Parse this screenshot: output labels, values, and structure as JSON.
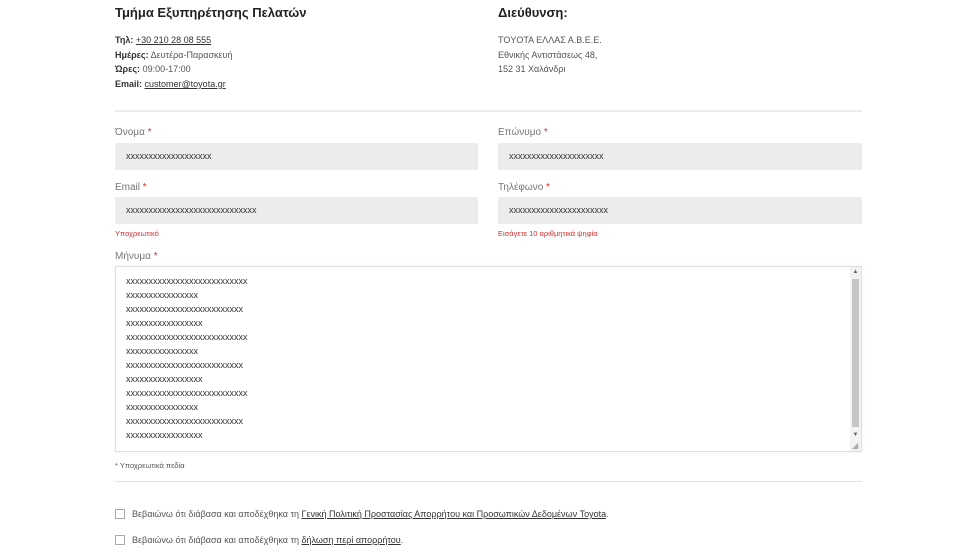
{
  "customer_service": {
    "title": "Τμήμα Εξυπηρέτησης Πελατών",
    "phone_label": "Τηλ:",
    "phone_value": "+30 210 28 08 555",
    "days_label": "Ημέρες:",
    "days_value": "Δευτέρα-Παρασκευή",
    "hours_label": "Ώρες:",
    "hours_value": "09:00-17:00",
    "email_label": "Email:",
    "email_value": "customer@toyota.gr"
  },
  "address": {
    "title": "Διεύθυνση:",
    "line1": "TOYOTA ΕΛΛΑΣ Α.Β.Ε.Ε.",
    "line2": "Εθνικής Αντιστάσεως 48,",
    "line3": "152 31 Χαλάνδρι"
  },
  "required_marker": "*",
  "form": {
    "first_name": {
      "label": "Όνομα",
      "value": "xxxxxxxxxxxxxxxxxxx"
    },
    "last_name": {
      "label": "Επώνυμο",
      "value": "xxxxxxxxxxxxxxxxxxxxx"
    },
    "email": {
      "label": "Email",
      "value": "xxxxxxxxxxxxxxxxxxxxxxxxxxxxx",
      "error": "Υποχρεωτικό"
    },
    "phone": {
      "label": "Τηλέφωνο",
      "value": "xxxxxxxxxxxxxxxxxxxxxx",
      "error": "Εισάγετε 10 αριθμητικά ψηφία"
    },
    "message": {
      "label": "Μήνυμα",
      "lines": [
        "xxxxxxxxxxxxxxxxxxxxxxxxxxx",
        "xxxxxxxxxxxxxxxx",
        "xxxxxxxxxxxxxxxxxxxxxxxxxx",
        "xxxxxxxxxxxxxxxxx",
        "xxxxxxxxxxxxxxxxxxxxxxxxxxx",
        "xxxxxxxxxxxxxxxx",
        "xxxxxxxxxxxxxxxxxxxxxxxxxx",
        "xxxxxxxxxxxxxxxxx",
        "xxxxxxxxxxxxxxxxxxxxxxxxxxx",
        "xxxxxxxxxxxxxxxx",
        "xxxxxxxxxxxxxxxxxxxxxxxxxx",
        "xxxxxxxxxxxxxxxxx"
      ]
    },
    "required_note": "* Υποχρεωτικά πεδία"
  },
  "consents": [
    {
      "prefix": "Βεβαιώνω ότι διάβασα και αποδέχθηκα τη ",
      "link": "Γενική Πολιτική Προστασίας Απορρήτου και Προσωπικών Δεδομένων Toyota",
      "suffix": "."
    },
    {
      "prefix": "Βεβαιώνω ότι διάβασα και αποδέχθηκα τη ",
      "link": "δήλωση περί απορρήτου",
      "suffix": "."
    }
  ]
}
